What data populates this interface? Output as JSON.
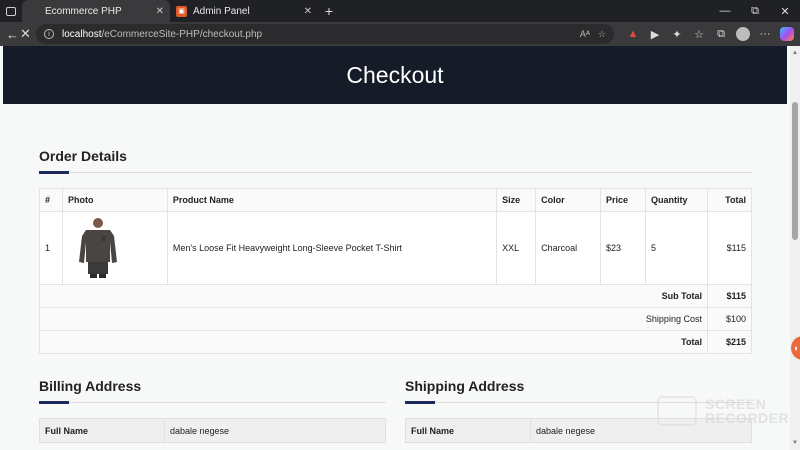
{
  "browser": {
    "tabs": [
      {
        "label": "Ecommerce PHP",
        "active": true,
        "favicon": "blank-page-icon"
      },
      {
        "label": "Admin Panel",
        "active": false,
        "favicon": "admin-panel-icon"
      }
    ],
    "url": "localhost/eCommerceSite-PHP/checkout.php",
    "url_host": "localhost",
    "url_path": "/eCommerceSite-PHP/checkout.php",
    "read_aloud_label": "Aᴬ",
    "new_tab_symbol": "+",
    "close_symbol": "✕"
  },
  "page": {
    "title": "Checkout",
    "order_details": {
      "heading": "Order Details",
      "columns": [
        "#",
        "Photo",
        "Product Name",
        "Size",
        "Color",
        "Price",
        "Quantity",
        "Total"
      ],
      "rows": [
        {
          "index": "1",
          "product_name": "Men's Loose Fit Heavyweight Long-Sleeve Pocket T-Shirt",
          "size": "XXL",
          "color": "Charcoal",
          "price": "$23",
          "quantity": "5",
          "total": "$115"
        }
      ],
      "subtotal_label": "Sub Total",
      "subtotal_value": "$115",
      "shipping_label": "Shipping Cost",
      "shipping_value": "$100",
      "total_label": "Total",
      "total_value": "$215"
    },
    "billing": {
      "heading": "Billing Address",
      "rows": [
        {
          "label": "Full Name",
          "value": "dabale negese"
        }
      ]
    },
    "shipping": {
      "heading": "Shipping Address",
      "rows": [
        {
          "label": "Full Name",
          "value": "dabale negese"
        }
      ]
    }
  },
  "overlay": {
    "watermark_line1": "SCREEN",
    "watermark_line2": "RECORDER"
  },
  "colors": {
    "banner": "#161b28",
    "accent_underline": "#1b2a5a",
    "browser_dark": "#202124"
  }
}
